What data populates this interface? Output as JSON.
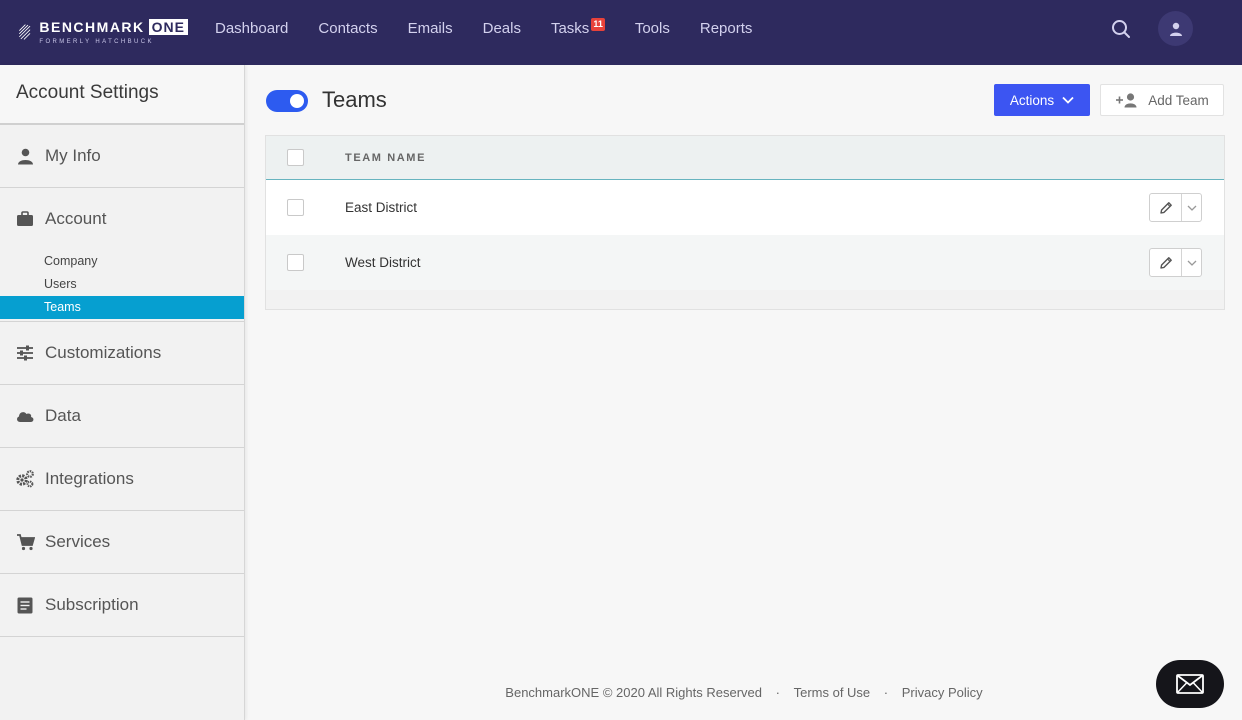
{
  "brand": {
    "name": "BENCHMARK",
    "suffix": "ONE",
    "tagline": "FORMERLY HATCHBUCK"
  },
  "nav": {
    "items": [
      {
        "label": "Dashboard"
      },
      {
        "label": "Contacts"
      },
      {
        "label": "Emails"
      },
      {
        "label": "Deals"
      },
      {
        "label": "Tasks",
        "badge": "11"
      },
      {
        "label": "Tools"
      },
      {
        "label": "Reports"
      }
    ],
    "search_icon": "search-icon",
    "avatar_icon": "user-icon"
  },
  "sidebar": {
    "title": "Account Settings",
    "my_info": "My Info",
    "account": {
      "label": "Account",
      "subitems": [
        "Company",
        "Users",
        "Teams"
      ],
      "active": "Teams"
    },
    "customizations": "Customizations",
    "data": "Data",
    "integrations": "Integrations",
    "services": "Services",
    "subscription": "Subscription"
  },
  "page": {
    "title": "Teams",
    "toggle_on": true,
    "actions_label": "Actions",
    "add_team_label": "Add Team"
  },
  "table": {
    "header": "TEAM NAME",
    "rows": [
      {
        "name": "East District"
      },
      {
        "name": "West District"
      }
    ]
  },
  "footer": {
    "copyright": "BenchmarkONE © 2020 All Rights Reserved",
    "sep": "·",
    "terms": "Terms of Use",
    "privacy": "Privacy Policy"
  },
  "colors": {
    "nav_bg": "#2e2a5e",
    "primary": "#3c55f2",
    "active_item": "#069fd0",
    "badge": "#e8423a"
  }
}
